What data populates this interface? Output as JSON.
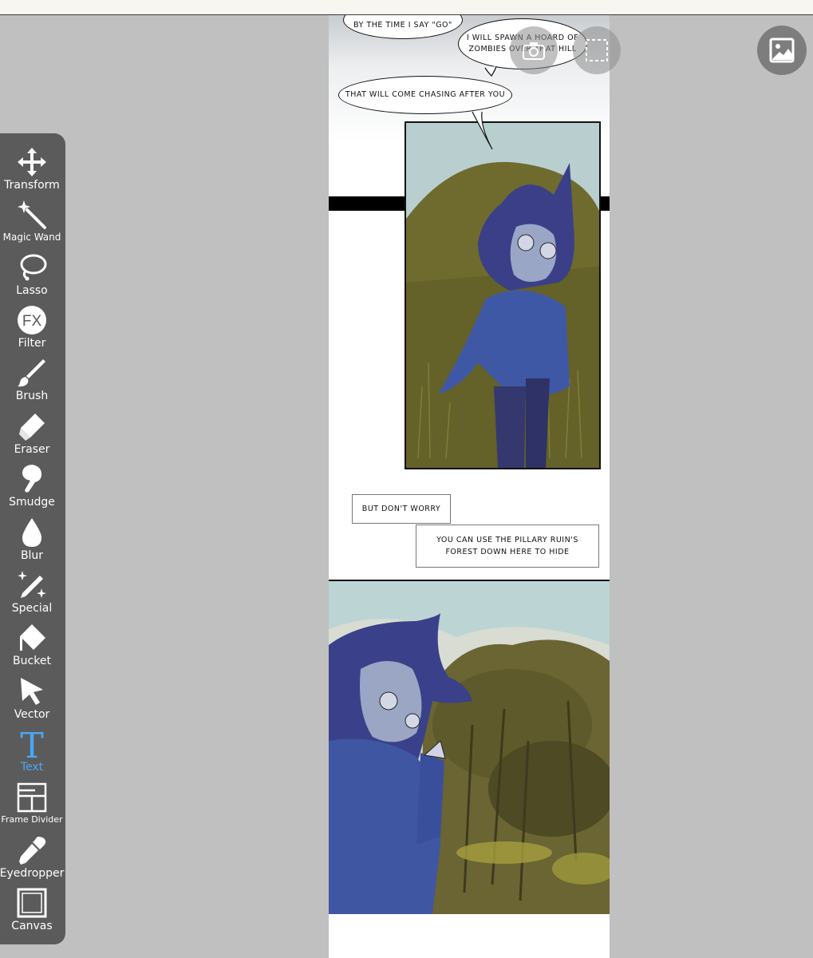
{
  "toolbar": {
    "tools": [
      {
        "label": "Transform",
        "icon": "move-arrows-icon"
      },
      {
        "label": "Magic Wand",
        "icon": "magic-wand-icon"
      },
      {
        "label": "Lasso",
        "icon": "lasso-icon"
      },
      {
        "label": "Filter",
        "icon": "fx-icon",
        "glyph": "FX"
      },
      {
        "label": "Brush",
        "icon": "brush-icon"
      },
      {
        "label": "Eraser",
        "icon": "eraser-icon"
      },
      {
        "label": "Smudge",
        "icon": "smudge-finger-icon"
      },
      {
        "label": "Blur",
        "icon": "droplet-icon"
      },
      {
        "label": "Special",
        "icon": "sparkle-pen-icon"
      },
      {
        "label": "Bucket",
        "icon": "bucket-icon"
      },
      {
        "label": "Vector",
        "icon": "cursor-arrow-icon"
      },
      {
        "label": "Text",
        "icon": "text-t-icon",
        "glyph": "T",
        "active": true
      },
      {
        "label": "Frame Divider",
        "icon": "frame-divider-icon"
      },
      {
        "label": "Eyedropper",
        "icon": "eyedropper-icon"
      },
      {
        "label": "Canvas",
        "icon": "canvas-frame-icon"
      }
    ],
    "active_color": "#4aa7f5"
  },
  "comic": {
    "bubble_1": "BY THE TIME I SAY \"GO\"",
    "bubble_2_line1": "I WILL SPAWN A HOARD OF",
    "bubble_2_line2": "ZOMBIES OVER THAT HILL",
    "bubble_3": "THAT WILL COME CHASING AFTER YOU",
    "caption_1": "BUT DON'T WORRY",
    "caption_2_line1": "YOU CAN USE THE PILLARY RUIN'S",
    "caption_2_line2": "FOREST DOWN HERE TO HIDE"
  },
  "overlay_buttons": {
    "camera": "camera-icon",
    "selection": "selection-marquee-icon",
    "gallery": "gallery-image-icon"
  }
}
